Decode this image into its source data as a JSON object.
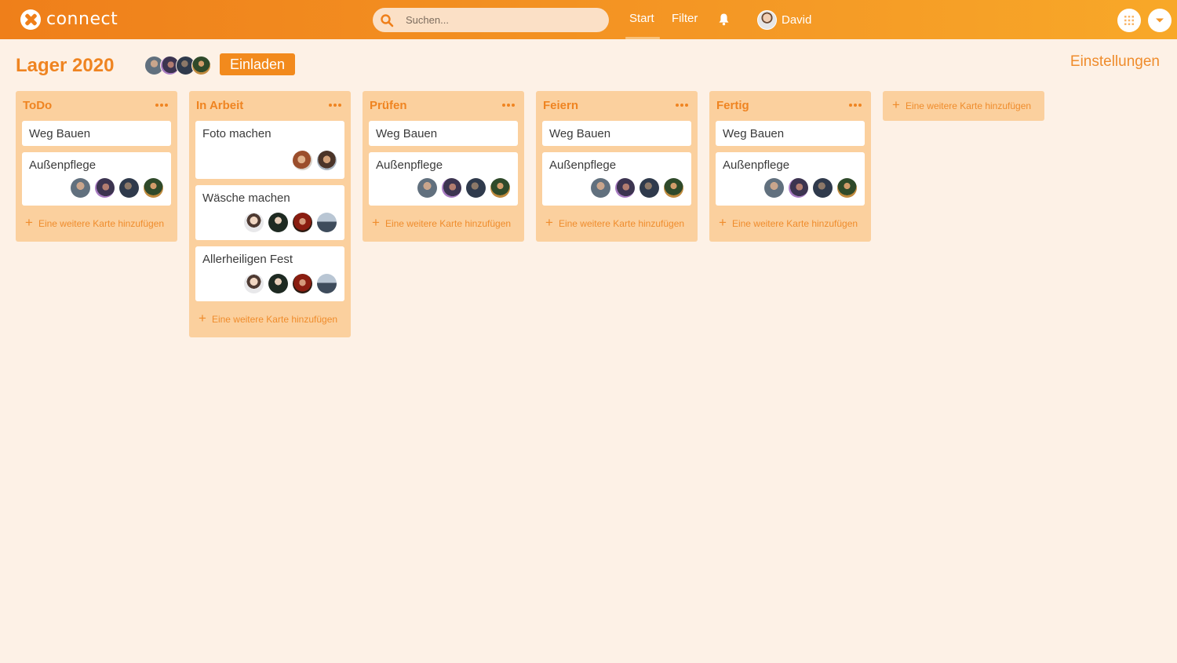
{
  "app": {
    "name": "connect"
  },
  "search": {
    "placeholder": "Suchen..."
  },
  "nav": {
    "start": "Start",
    "filter": "Filter"
  },
  "user": {
    "name": "David"
  },
  "board": {
    "title": "Lager 2020",
    "invite_label": "Einladen",
    "settings_label": "Einstellungen",
    "add_list_label": "Eine weitere Karte hinzufügen"
  },
  "lists": [
    {
      "title": "ToDo",
      "add_label": "Eine weitere Karte hinzufügen",
      "cards": [
        {
          "title": "Weg Bauen"
        },
        {
          "title": "Außenpflege"
        }
      ]
    },
    {
      "title": "In Arbeit",
      "add_label": "Eine weitere Karte hinzufügen",
      "cards": [
        {
          "title": "Foto machen"
        },
        {
          "title": "Wäsche machen"
        },
        {
          "title": "Allerheiligen Fest"
        }
      ]
    },
    {
      "title": "Prüfen",
      "add_label": "Eine weitere Karte hinzufügen",
      "cards": [
        {
          "title": "Weg Bauen"
        },
        {
          "title": "Außenpflege"
        }
      ]
    },
    {
      "title": "Feiern",
      "add_label": "Eine weitere Karte hinzufügen",
      "cards": [
        {
          "title": "Weg Bauen"
        },
        {
          "title": "Außenpflege"
        }
      ]
    },
    {
      "title": "Fertig",
      "add_label": "Eine weitere Karte hinzufügen",
      "cards": [
        {
          "title": "Weg Bauen"
        },
        {
          "title": "Außenpflege"
        }
      ]
    }
  ],
  "colors": {
    "accent": "#ef8421",
    "topbar_start": "#ef7f1a",
    "topbar_end": "#f8a828",
    "list_background": "#fbd09e",
    "page_background": "#fdf1e6"
  },
  "icons": {
    "logo": "connect-logo-icon",
    "search": "search-icon",
    "bell": "bell-icon",
    "apps": "apps-grid-icon",
    "dropdown": "chevron-down-icon",
    "list_menu": "more-horizontal-icon",
    "add": "plus-icon"
  }
}
